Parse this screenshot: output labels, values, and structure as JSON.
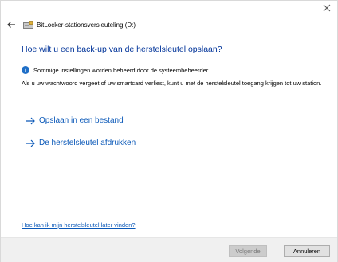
{
  "window": {
    "title": "BitLocker-stationsversleuteling (D:)"
  },
  "content": {
    "heading": "Hoe wilt u een back-up van de herstelsleutel opslaan?",
    "info_text": "Sommige instellingen worden beheerd door de systeembeheerder.",
    "body_text": "Als u uw wachtwoord vergeet of uw smartcard verliest, kunt u met de herstelsleutel toegang krijgen tot uw station.",
    "options": [
      {
        "label": "Opslaan in een bestand"
      },
      {
        "label": "De herstelsleutel afdrukken"
      }
    ],
    "help_link": "Hoe kan ik mijn herstelsleutel later vinden?"
  },
  "footer": {
    "next_label": "Volgende",
    "cancel_label": "Annuleren"
  },
  "colors": {
    "heading": "#003399",
    "link": "#0a58b8",
    "info_icon": "#1f6fc7",
    "footer_bg": "#f0f0f0"
  },
  "icons": {
    "close": "close-icon",
    "back": "back-arrow-icon",
    "app": "drive-icon",
    "info": "info-icon",
    "option_arrow": "right-arrow-icon"
  }
}
